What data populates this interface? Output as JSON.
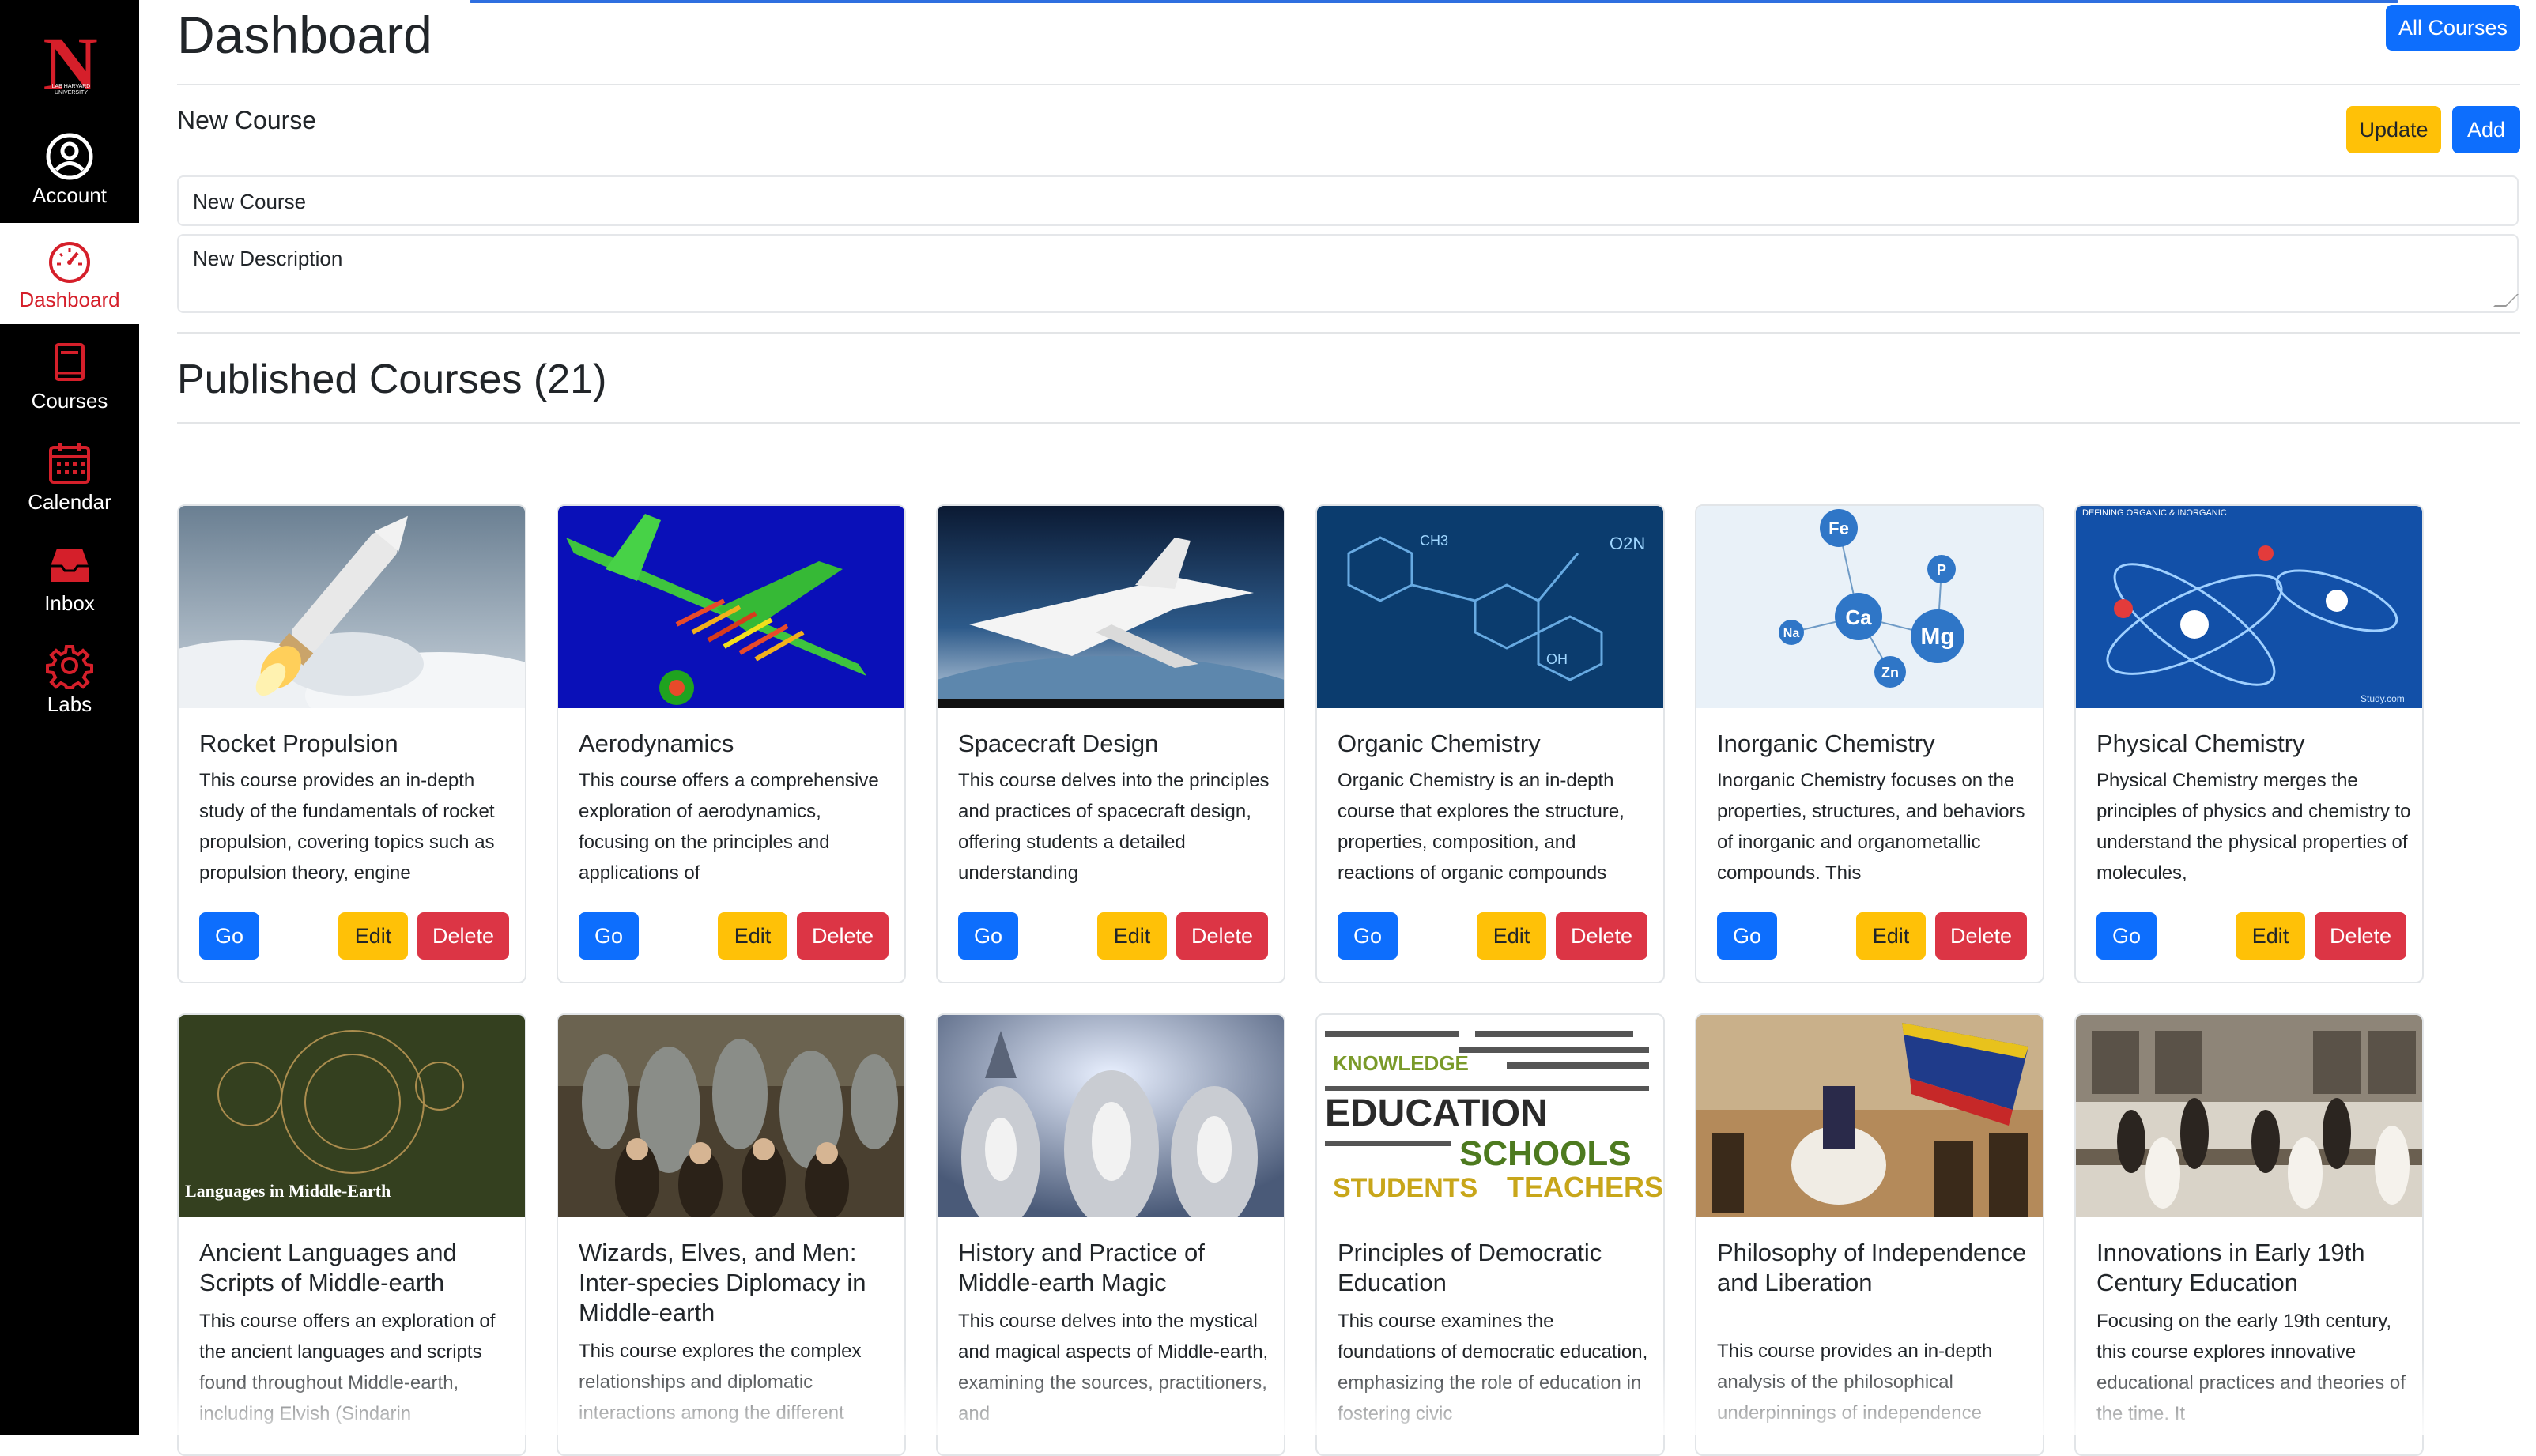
{
  "sidebar": {
    "logo_letter": "N",
    "logo_text": "LAB HARVARD UNIVERSITY",
    "items": [
      {
        "label": "Account",
        "icon": "account-icon"
      },
      {
        "label": "Dashboard",
        "icon": "dashboard-icon",
        "active": true
      },
      {
        "label": "Courses",
        "icon": "courses-icon"
      },
      {
        "label": "Calendar",
        "icon": "calendar-icon"
      },
      {
        "label": "Inbox",
        "icon": "inbox-icon"
      },
      {
        "label": "Labs",
        "icon": "labs-icon"
      }
    ],
    "active_color": "#d51f2a"
  },
  "header": {
    "title": "Dashboard",
    "all_courses_label": "All Courses"
  },
  "editor": {
    "heading": "New Course",
    "update_label": "Update",
    "add_label": "Add",
    "name_value": "New Course",
    "description_value": "New Description"
  },
  "published": {
    "heading": "Published Courses (21)"
  },
  "card_buttons": {
    "go": "Go",
    "edit": "Edit",
    "delete": "Delete"
  },
  "courses": [
    {
      "title": "Rocket Propulsion",
      "image": "rocket-launch",
      "description": "This course provides an in-depth study of the fundamentals of rocket propulsion, covering topics such as propulsion theory, engine"
    },
    {
      "title": "Aerodynamics",
      "image": "aircraft-cfd-model",
      "description": "This course offers a comprehensive exploration of aerodynamics, focusing on the principles and applications of"
    },
    {
      "title": "Spacecraft Design",
      "image": "space-shuttle",
      "description": "This course delves into the principles and practices of spacecraft design, offering students a detailed understanding"
    },
    {
      "title": "Organic Chemistry",
      "image": "molecule-structure",
      "description": "Organic Chemistry is an in-depth course that explores the structure, properties, composition, and reactions of organic compounds"
    },
    {
      "title": "Inorganic Chemistry",
      "image": "element-molecules",
      "description": "Inorganic Chemistry focuses on the properties, structures, and behaviors of inorganic and organometallic compounds. This"
    },
    {
      "title": "Physical Chemistry",
      "image": "atom-model",
      "description": "Physical Chemistry merges the principles of physics and chemistry to understand the physical properties of molecules,"
    },
    {
      "title": "Ancient Languages and Scripts of Middle-earth",
      "image": "elvish-scripts",
      "description": "This course offers an exploration of the ancient languages and scripts found throughout Middle-earth, including Elvish (Sindarin"
    },
    {
      "title": "Wizards, Elves, and Men: Inter-species Diplomacy in Middle-earth",
      "image": "fellowship-group",
      "description": "This course explores the complex relationships and diplomatic interactions among the different"
    },
    {
      "title": "History and Practice of Middle-earth Magic",
      "image": "wizards",
      "description": "This course delves into the mystical and magical aspects of Middle-earth, examining the sources, practitioners, and"
    },
    {
      "title": "Principles of Democratic Education",
      "image": "education-word-cloud",
      "description": "This course examines the foundations of democratic education, emphasizing the role of education in fostering civic"
    },
    {
      "title": "Philosophy of Independence and Liberation",
      "image": "historical-painting",
      "description": "This course provides an in-depth analysis of the philosophical underpinnings of independence"
    },
    {
      "title": "Innovations in Early 19th Century Education",
      "image": "historic-classroom",
      "description": "Focusing on the early 19th century, this course explores innovative educational practices and theories of the time. It"
    }
  ],
  "image_overlays": {
    "inorganic_symbols": [
      "Fe",
      "P",
      "Ca",
      "Mg",
      "Na",
      "Zn"
    ],
    "organic_labels": [
      "CH3",
      "O2N",
      "OH"
    ],
    "physical_caption": "DEFINING ORGANIC & INORGANIC",
    "physical_watermark": "Study.com",
    "elvish_caption": "Languages in Middle-Earth",
    "wordcloud_words": [
      "EDUCATION",
      "SCHOOLS",
      "TEACHERS",
      "STUDENTS",
      "KNOWLEDGE"
    ]
  }
}
